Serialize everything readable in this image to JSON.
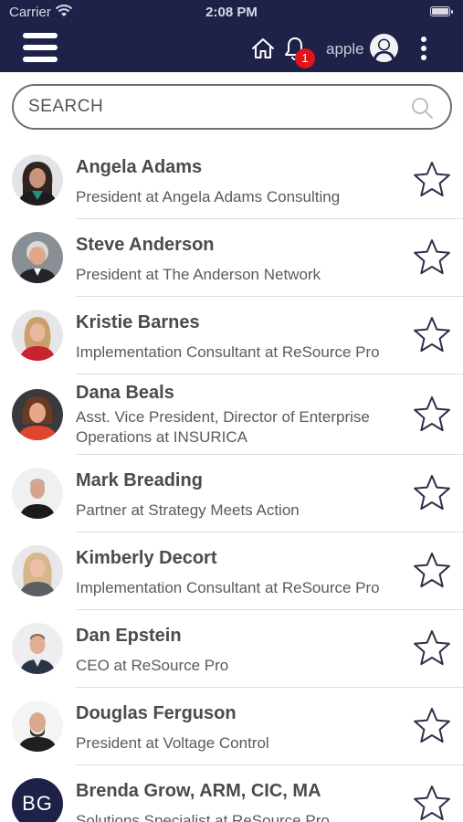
{
  "status_bar": {
    "carrier": "Carrier",
    "time": "2:08 PM"
  },
  "nav": {
    "user_name": "apple",
    "notification_count": "1",
    "icons": [
      "menu-icon",
      "home-icon",
      "bell-icon",
      "user-avatar-icon",
      "more-vertical-icon"
    ]
  },
  "search": {
    "placeholder": "SEARCH",
    "value": ""
  },
  "colors": {
    "nav_bg": "#1e2148",
    "badge": "#e0141c",
    "text_name": "#4a4a4f",
    "text_title": "#5a5a5f"
  },
  "contacts": [
    {
      "name": "Angela Adams",
      "title": "President at Angela Adams Consulting",
      "avatar": "photo",
      "favorite": false
    },
    {
      "name": "Steve Anderson",
      "title": "President at The Anderson Network",
      "avatar": "photo",
      "favorite": false
    },
    {
      "name": "Kristie Barnes",
      "title": "Implementation Consultant at ReSource Pro",
      "avatar": "photo",
      "favorite": false
    },
    {
      "name": "Dana Beals",
      "title": "Asst. Vice President, Director of Enterprise Operations at INSURICA",
      "avatar": "photo",
      "favorite": false
    },
    {
      "name": "Mark Breading",
      "title": "Partner at Strategy Meets Action",
      "avatar": "photo",
      "favorite": false
    },
    {
      "name": "Kimberly Decort",
      "title": "Implementation Consultant at ReSource Pro",
      "avatar": "photo",
      "favorite": false
    },
    {
      "name": "Dan Epstein",
      "title": "CEO at ReSource Pro",
      "avatar": "photo",
      "favorite": false
    },
    {
      "name": "Douglas Ferguson",
      "title": "President at Voltage Control",
      "avatar": "photo",
      "favorite": false
    },
    {
      "name": "Brenda Grow, ARM, CIC, MA",
      "title": "Solutions Specialist at ReSource Pro",
      "avatar": "BG",
      "favorite": false
    }
  ]
}
